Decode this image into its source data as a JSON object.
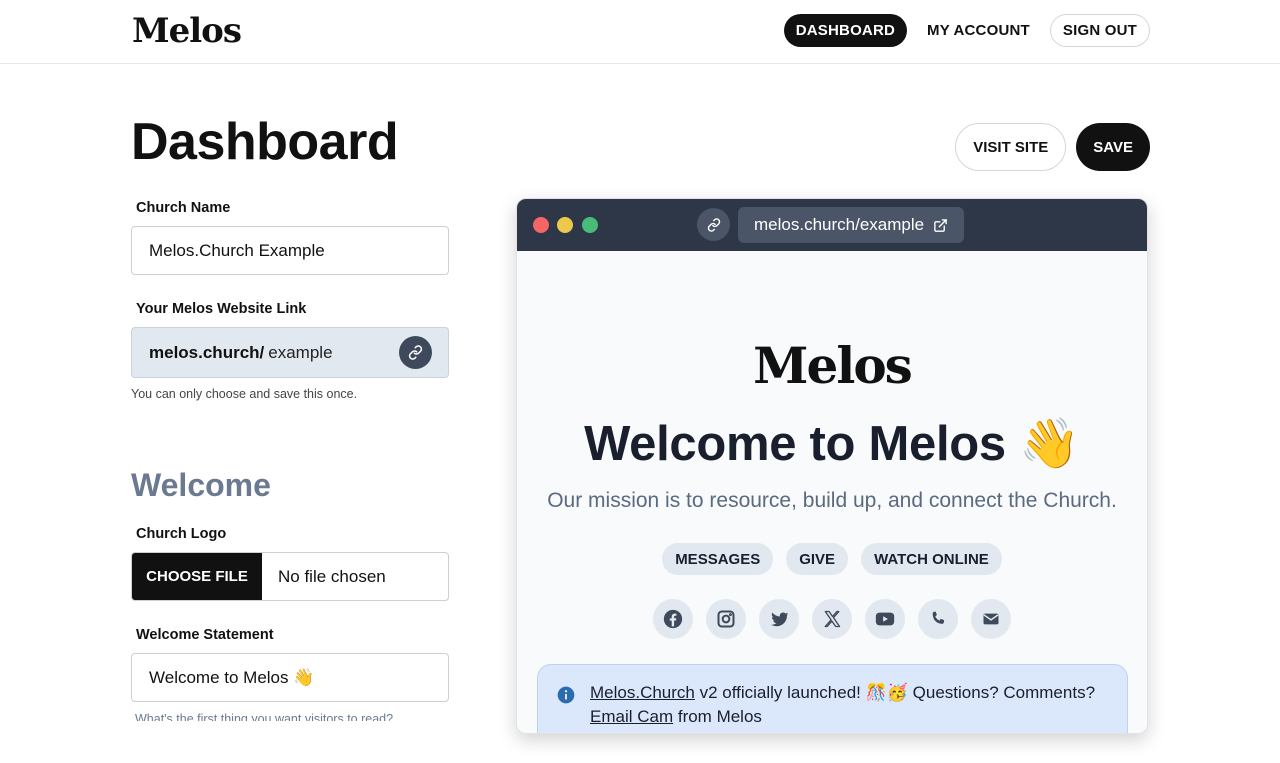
{
  "app": {
    "logo_text": "Melos"
  },
  "nav": {
    "dashboard": "DASHBOARD",
    "account": "MY ACCOUNT",
    "signout": "SIGN OUT"
  },
  "header": {
    "title": "Dashboard",
    "visit_site": "VISIT SITE",
    "save": "SAVE"
  },
  "form": {
    "church_name_label": "Church Name",
    "church_name_value": "Melos.Church Example",
    "link_label": "Your Melos Website Link",
    "link_prefix": "melos.church/",
    "link_slug": "example",
    "link_help": "You can only choose and save this once.",
    "welcome_section": "Welcome",
    "logo_label": "Church Logo",
    "choose_file": "CHOOSE FILE",
    "no_file": "No file chosen",
    "statement_label": "Welcome Statement",
    "statement_value": "Welcome to Melos 👋",
    "statement_help": "What's the first thing you want visitors to read?"
  },
  "preview": {
    "url": "melos.church/example",
    "logo_text": "Melos",
    "title": "Welcome to Melos 👋",
    "mission": "Our mission is to resource, build up, and connect the Church.",
    "links": [
      "MESSAGES",
      "GIVE",
      "WATCH ONLINE"
    ],
    "social_icons": [
      "facebook-icon",
      "instagram-icon",
      "twitter-icon",
      "x-icon",
      "youtube-icon",
      "phone-icon",
      "email-icon"
    ],
    "notice": {
      "link1": "Melos.Church",
      "text1": " v2 officially launched! 🎊🥳 Questions? Comments?",
      "link2": "Email Cam",
      "text2": " from Melos"
    }
  },
  "colors": {
    "dark": "#111111",
    "slate": "#6b7a90",
    "preview_bar": "#2d3748",
    "chip_bg": "#e2e8f0",
    "notice_bg": "#dbe8fb",
    "info_blue": "#2b6cb0"
  }
}
